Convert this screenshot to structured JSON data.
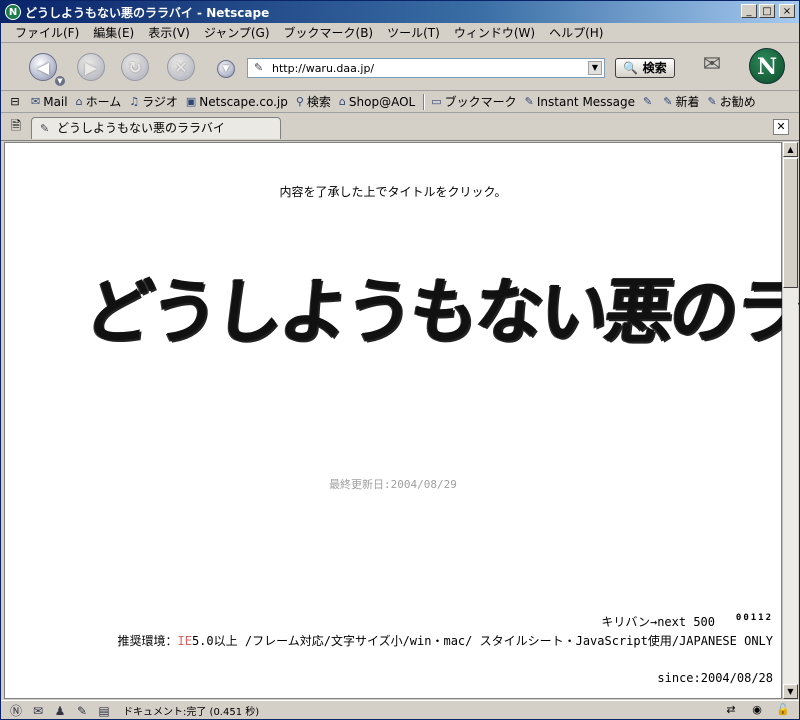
{
  "window": {
    "title": "どうしようもない悪のララバイ - Netscape",
    "buttons": {
      "minimize": "_",
      "maximize": "□",
      "close": "×"
    }
  },
  "menu": [
    "ファイル(F)",
    "編集(E)",
    "表示(V)",
    "ジャンプ(G)",
    "ブックマーク(B)",
    "ツール(T)",
    "ウィンドウ(W)",
    "ヘルプ(H)"
  ],
  "nav": {
    "url": "http://waru.daa.jp/",
    "search_label": "検索"
  },
  "personal_toolbar": [
    {
      "icon": "mail-icon",
      "label": "Mail"
    },
    {
      "icon": "home-icon",
      "label": "ホーム"
    },
    {
      "icon": "radio-icon",
      "label": "ラジオ"
    },
    {
      "icon": "my-netscape-icon",
      "label": "Netscape.co.jp"
    },
    {
      "icon": "search-icon",
      "label": "検索"
    },
    {
      "icon": "shop-icon",
      "label": "Shop@AOL"
    },
    {
      "icon": "bookmark-folder-icon",
      "label": "ブックマーク"
    },
    {
      "icon": "instant-message-icon",
      "label": "Instant Message"
    },
    {
      "icon": "bookmark-icon",
      "label": ""
    },
    {
      "icon": "bookmark-icon",
      "label": "新着"
    },
    {
      "icon": "bookmark-icon",
      "label": "お勧め"
    }
  ],
  "tab": {
    "label": "どうしようもない悪のララバイ"
  },
  "page": {
    "notice": "内容を了承した上でタイトルをクリック。",
    "logo_text": "どうしようもない悪のララバイ",
    "updated": "最終更新日:2004/08/29",
    "kiriban": "キリバン→next 500",
    "counter": "00112",
    "env_prefix": "推奨環境：",
    "env_ie": "IE",
    "env_rest": "5.0以上 /フレーム対応/文字サイズ小/win・mac/ スタイルシート・JavaScript使用/JAPANESE ONLY",
    "since": "since:2004/08/28"
  },
  "status": {
    "text": "ドキュメント:完了 (0.451 秒)"
  }
}
